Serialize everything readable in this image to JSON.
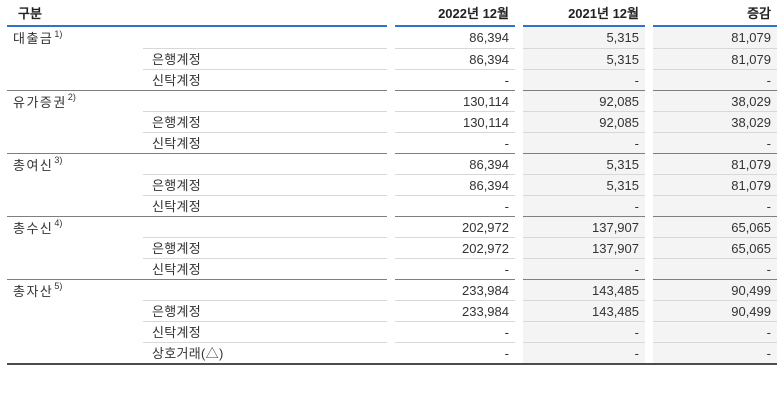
{
  "chart_data": {
    "type": "table",
    "columns": [
      "구분",
      "2022년 12월",
      "2021년 12월",
      "증감"
    ],
    "rows": [
      {
        "label": "대출금",
        "sup": "1)",
        "level": 0,
        "values": [
          "86,394",
          "5,315",
          "81,079"
        ]
      },
      {
        "label": "은행계정",
        "level": 1,
        "values": [
          "86,394",
          "5,315",
          "81,079"
        ]
      },
      {
        "label": "신탁계정",
        "level": 1,
        "values": [
          "-",
          "-",
          "-"
        ]
      },
      {
        "label": "유가증권",
        "sup": "2)",
        "level": 0,
        "values": [
          "130,114",
          "92,085",
          "38,029"
        ]
      },
      {
        "label": "은행계정",
        "level": 1,
        "values": [
          "130,114",
          "92,085",
          "38,029"
        ]
      },
      {
        "label": "신탁계정",
        "level": 1,
        "values": [
          "-",
          "-",
          "-"
        ]
      },
      {
        "label": "총여신",
        "sup": "3)",
        "level": 0,
        "values": [
          "86,394",
          "5,315",
          "81,079"
        ]
      },
      {
        "label": "은행계정",
        "level": 1,
        "values": [
          "86,394",
          "5,315",
          "81,079"
        ]
      },
      {
        "label": "신탁계정",
        "level": 1,
        "values": [
          "-",
          "-",
          "-"
        ]
      },
      {
        "label": "총수신",
        "sup": "4)",
        "level": 0,
        "values": [
          "202,972",
          "137,907",
          "65,065"
        ]
      },
      {
        "label": "은행계정",
        "level": 1,
        "values": [
          "202,972",
          "137,907",
          "65,065"
        ]
      },
      {
        "label": "신탁계정",
        "level": 1,
        "values": [
          "-",
          "-",
          "-"
        ]
      },
      {
        "label": "총자산",
        "sup": "5)",
        "level": 0,
        "values": [
          "233,984",
          "143,485",
          "90,499"
        ]
      },
      {
        "label": "은행계정",
        "level": 1,
        "values": [
          "233,984",
          "143,485",
          "90,499"
        ]
      },
      {
        "label": "신탁계정",
        "level": 1,
        "values": [
          "-",
          "-",
          "-"
        ]
      },
      {
        "label": "상호거래(△)",
        "level": 1,
        "values": [
          "-",
          "-",
          "-"
        ]
      }
    ],
    "layout": {
      "header_accent_color": "#2e74c8",
      "shaded_columns": [
        "2021년 12월",
        "증감"
      ],
      "shaded_column_bg": "#f4f4f4"
    }
  }
}
